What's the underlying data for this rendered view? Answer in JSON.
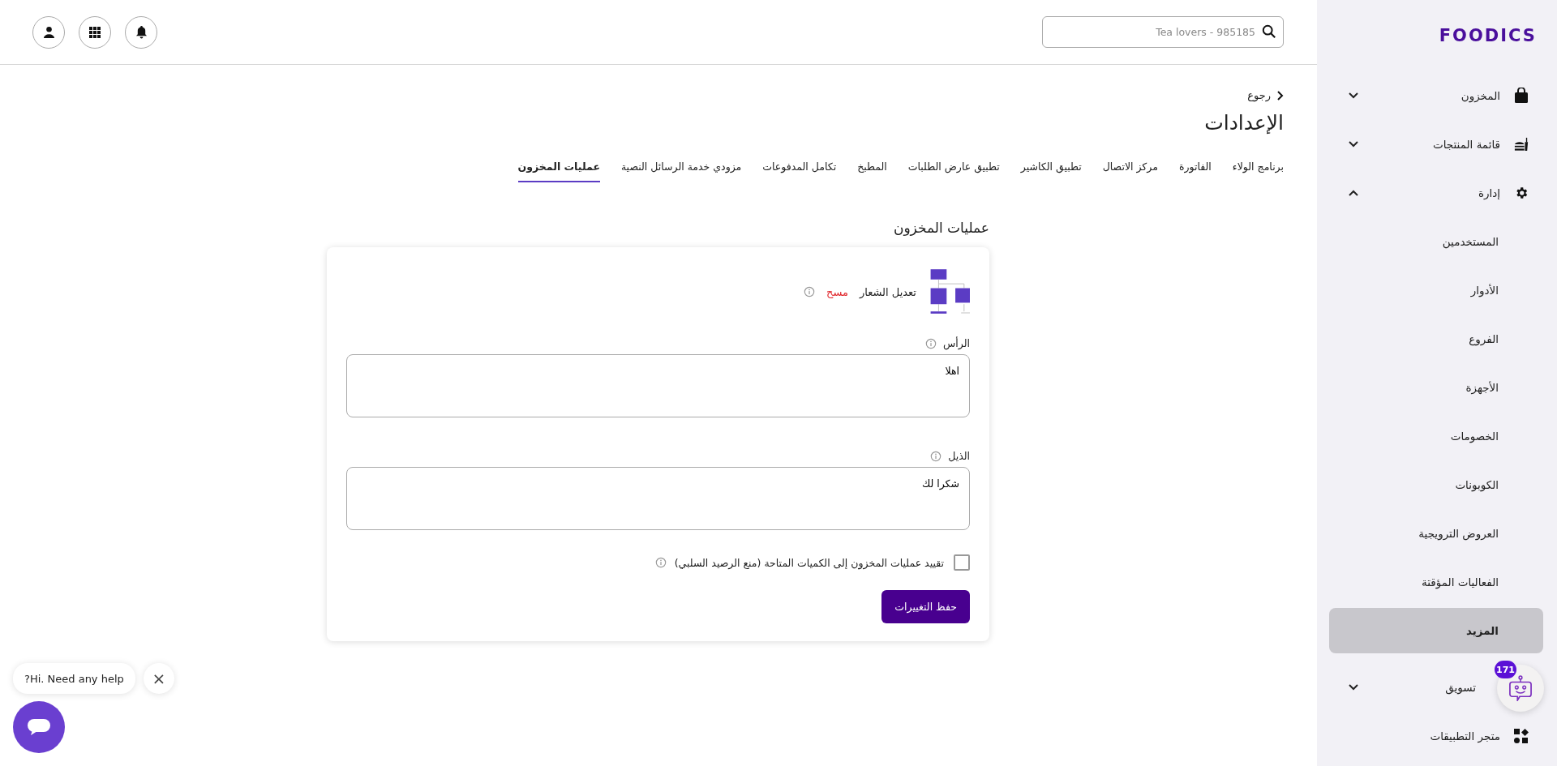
{
  "header": {
    "search": {
      "placeholder": "Tea lovers - 985185"
    }
  },
  "sidebar": {
    "logo": "FOODICS",
    "items": [
      {
        "kind": "group",
        "label": "المخزون",
        "expanded": false
      },
      {
        "kind": "group",
        "label": "قائمة المنتجات",
        "expanded": false
      },
      {
        "kind": "group",
        "label": "إدارة",
        "expanded": true,
        "children": [
          {
            "label": "المستخدمين",
            "selected": false
          },
          {
            "label": "الأدوار",
            "selected": false
          },
          {
            "label": "الفروع",
            "selected": false
          },
          {
            "label": "الأجهزة",
            "selected": false
          },
          {
            "label": "الخصومات",
            "selected": false
          },
          {
            "label": "الكوبونات",
            "selected": false
          },
          {
            "label": "العروض الترويجية",
            "selected": false
          },
          {
            "label": "الفعاليات المؤقتة",
            "selected": false
          },
          {
            "label": "المزيد",
            "selected": true
          }
        ]
      },
      {
        "kind": "group",
        "label": "تسويق",
        "expanded": false
      },
      {
        "kind": "link",
        "label": "متجر التطبيقات"
      }
    ]
  },
  "back": "رجوع",
  "title": "الإعدادات",
  "tabs": [
    {
      "label": "برنامج الولاء",
      "selected": false
    },
    {
      "label": "الفاتورة",
      "selected": false
    },
    {
      "label": "مركز الاتصال",
      "selected": false
    },
    {
      "label": "تطبيق الكاشير",
      "selected": false
    },
    {
      "label": "تطبيق عارض الطلبات",
      "selected": false
    },
    {
      "label": "المطبخ",
      "selected": false
    },
    {
      "label": "تكامل المدفوعات",
      "selected": false
    },
    {
      "label": "مزودي خدمة الرسائل النصية",
      "selected": false
    },
    {
      "label": "عمليات المخزون",
      "selected": true
    }
  ],
  "section": {
    "title": "عمليات المخزون",
    "logo": {
      "edit": "تعديل الشعار",
      "delete": "مسح"
    },
    "fields": [
      {
        "label": "الرأس",
        "value": "اهلا"
      },
      {
        "label": "الذيل",
        "value": "شكرا لك"
      }
    ],
    "checkbox": {
      "label": "تقييد عمليات المخزون إلى الكميات المتاحة (منع الرصيد السلبي)",
      "checked": false
    },
    "save": "حفظ التغييرات"
  },
  "chat": {
    "greeting": "Hi. Need any help?",
    "close": "×"
  },
  "bot": {
    "badge": "171"
  }
}
